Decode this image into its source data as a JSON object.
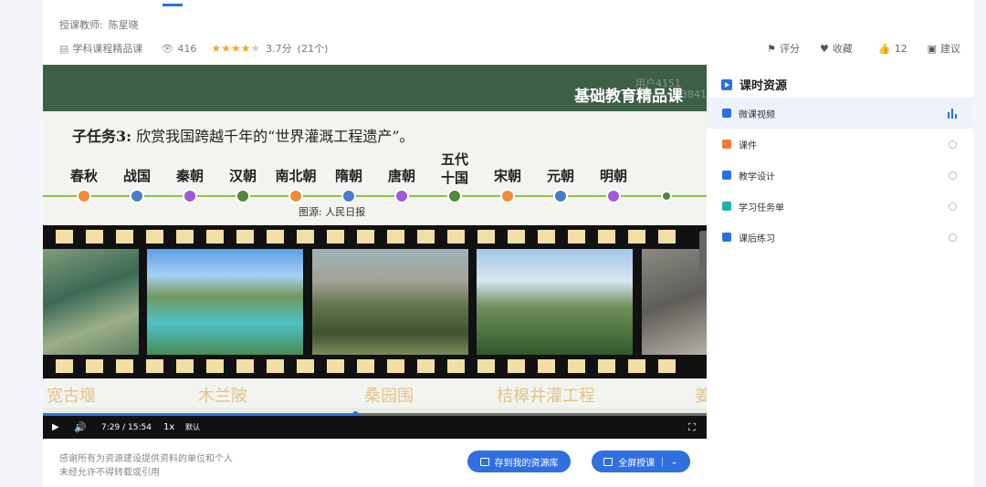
{
  "course": {
    "teacher_label": "授课教师:",
    "teacher_name": "陈星晓",
    "category": "学科课程精品课",
    "views": "416",
    "rating": "3.7分",
    "rating_count": "(21个)",
    "rating_value": 3.7,
    "rating_max": 5
  },
  "actions": {
    "rate": "评分",
    "favorite": "收藏",
    "like_count": "12",
    "suggest": "建议"
  },
  "slide": {
    "banner": "基础教育精品课",
    "watermark_1": "用户4151",
    "watermark_2": "03841",
    "task_prefix": "子任务3:",
    "task_text": "欣赏我国跨越千年的“世界灌溉工程遗产”。",
    "dynasties": [
      "春秋",
      "战国",
      "秦朝",
      "汉朝",
      "南北朝",
      "隋朝",
      "唐朝",
      "五代\n十国",
      "宋朝",
      "元朝",
      "明朝"
    ],
    "dot_colors": [
      "#f08a3c",
      "#4a7cc9",
      "#a25ad9",
      "#4f8a3a",
      "#f08a3c",
      "#4a7cc9",
      "#a25ad9",
      "#4f8a3a",
      "#f08a3c",
      "#4a7cc9",
      "#a25ad9",
      "#4f8a3a"
    ],
    "source": "图源: 人民日报",
    "captions": [
      "宽古堰",
      "木兰陂",
      "桑园围",
      "桔槔井灌工程",
      "姜"
    ]
  },
  "player": {
    "current_time": "7:29",
    "separator": "/",
    "duration": "15:54",
    "speed": "1x",
    "quality": "默认",
    "progress": 0.471
  },
  "panel": {
    "title": "课时资源",
    "items": [
      {
        "label": "微课视频",
        "active": true,
        "color": "#2a6fe8"
      },
      {
        "label": "课件",
        "active": false,
        "color": "#f07b3a"
      },
      {
        "label": "教学设计",
        "active": false,
        "color": "#2a6fe8"
      },
      {
        "label": "学习任务单",
        "active": false,
        "color": "#1bb2a8"
      },
      {
        "label": "课后练习",
        "active": false,
        "color": "#2a6fe8"
      }
    ]
  },
  "footer": {
    "thanks_line1": "感谢所有为资源建设提供资料的单位和个人",
    "thanks_line2": "未经允许不得转载或引用",
    "save_button": "存到我的资源库",
    "fullscreen_button": "全屏授课"
  }
}
